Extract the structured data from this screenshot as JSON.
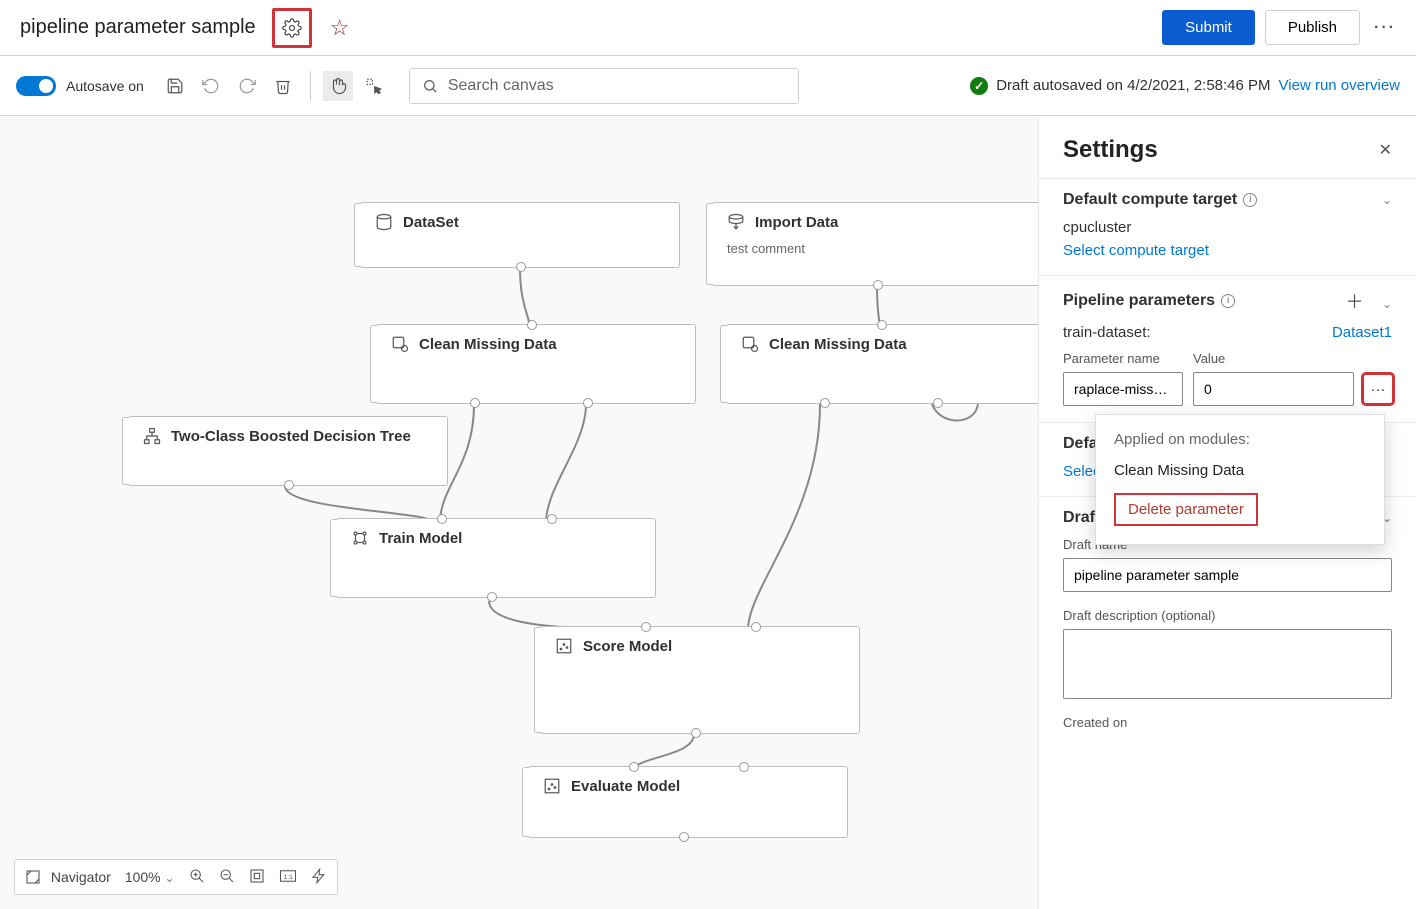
{
  "header": {
    "title": "pipeline parameter sample",
    "submit": "Submit",
    "publish": "Publish"
  },
  "toolbar": {
    "autosave_label": "Autosave on",
    "search_placeholder": "Search canvas",
    "status_text": "Draft autosaved on 4/2/2021, 2:58:46 PM",
    "view_overview": "View run overview"
  },
  "nodes": {
    "dataset": "DataSet",
    "import_data": "Import Data",
    "import_data_sub": "test comment",
    "clean1": "Clean Missing Data",
    "clean2": "Clean Missing Data",
    "tcbt": "Two-Class Boosted Decision Tree",
    "train": "Train Model",
    "score": "Score Model",
    "eval": "Evaluate Model"
  },
  "panel": {
    "title": "Settings",
    "compute": {
      "heading": "Default compute target",
      "value": "cpucluster",
      "link": "Select compute target"
    },
    "params": {
      "heading": "Pipeline parameters",
      "train_label": "train-dataset:",
      "train_value": "Dataset1",
      "name_label": "Parameter name",
      "value_label": "Value",
      "name_val": "raplace-miss…",
      "value_val": "0",
      "default_heading": "Default",
      "default_link": "Select c"
    },
    "popup": {
      "applied": "Applied on modules:",
      "module": "Clean Missing Data",
      "delete": "Delete parameter"
    },
    "draft": {
      "heading": "Draft details",
      "name_label": "Draft name",
      "name_value": "pipeline parameter sample",
      "desc_label": "Draft description (optional)",
      "created_label": "Created on"
    }
  },
  "bottombar": {
    "navigator": "Navigator",
    "zoom": "100%"
  },
  "colors": {
    "primary": "#0078d4",
    "danger": "#d13438"
  }
}
